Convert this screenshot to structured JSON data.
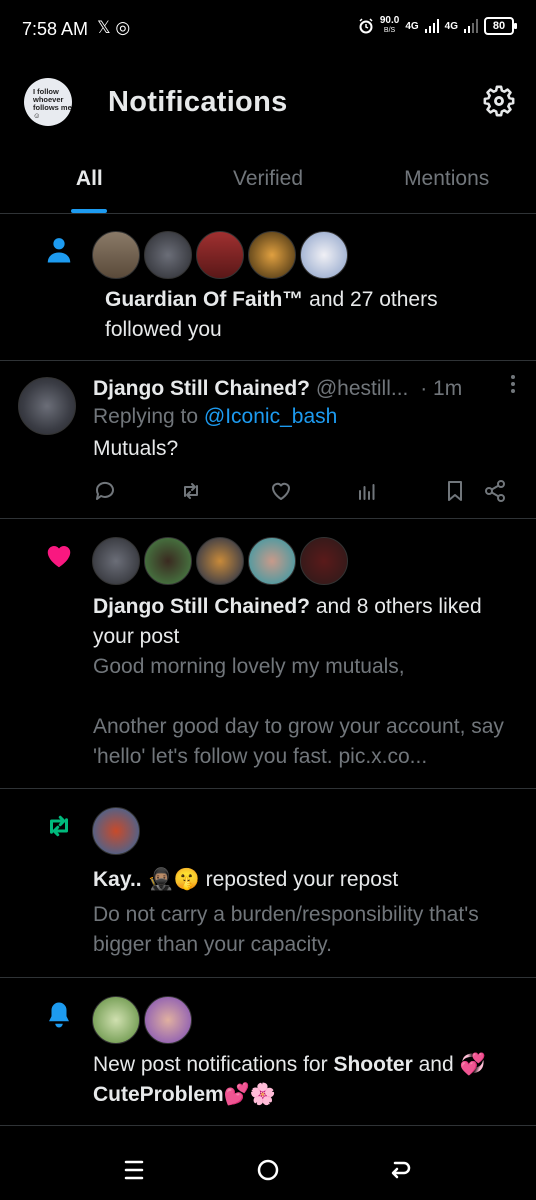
{
  "status_bar": {
    "time": "7:58 AM",
    "app_icons": "𝕏 ◎",
    "speed_value": "90.0",
    "speed_unit": "B/S",
    "network_1": "4G",
    "network_2": "4G",
    "battery": "80"
  },
  "header": {
    "avatar_text": "I follow whoever follows me ☺",
    "title": "Notifications"
  },
  "tabs": [
    {
      "label": "All",
      "active": true
    },
    {
      "label": "Verified",
      "active": false
    },
    {
      "label": "Mentions",
      "active": false
    }
  ],
  "notifications": {
    "follow": {
      "icon": "person-icon",
      "name": "Guardian Of Faith™",
      "rest": " and 27 others followed you",
      "avatar_colors": [
        "#7a6b5a",
        "#4a4a55",
        "#8a2a2a",
        "#b87a2a",
        "#d8dde8"
      ]
    },
    "reply": {
      "name": "Django Still Chained?",
      "handle": "@hestill...",
      "time": "· 1m",
      "replying_prefix": "Replying to ",
      "replying_handle": "@Iconic_bash",
      "body": "Mutuals?"
    },
    "like": {
      "icon": "heart-icon",
      "name": "Django Still Chained?",
      "rest": " and 8 others liked your post",
      "preview_line1": "Good morning lovely my mutuals,",
      "preview_line2": "Another good day to grow your account, say 'hello' let's follow you fast. pic.x.co...",
      "avatar_colors": [
        "#4a4a55",
        "#3a6a3a",
        "#2a3a6a",
        "#2a8a8a",
        "#6a2a2a"
      ]
    },
    "repost": {
      "icon": "repost-icon",
      "name": "Kay.. 🥷🏽🤫",
      "rest": " reposted your repost",
      "preview": "Do not carry a burden/responsibility that's bigger than your capacity.",
      "avatar_colors": [
        "#2a6aa8"
      ]
    },
    "bell": {
      "icon": "bell-icon",
      "prefix": "New post notifications for ",
      "name1": "Shooter",
      "middle": " and ",
      "name2": "💞CuteProblem💕🌸",
      "avatar_colors": [
        "#6a9a4a",
        "#9a5ab8"
      ]
    }
  },
  "colors": {
    "accent": "#1d9bf0",
    "like": "#f91880",
    "repost": "#00ba7c",
    "muted": "#71767b"
  }
}
